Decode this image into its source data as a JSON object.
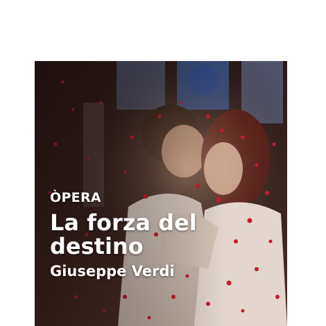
{
  "card": {
    "category": "ÒPERA",
    "title_line1": "La forza del",
    "title_line2": "destino",
    "composer": "Giuseppe Verdi"
  },
  "colors": {
    "background": "#ffffff",
    "text": "#ffffff",
    "petals": "#c41e2a"
  },
  "icons": {
    "artwork": "couple-embracing-photo"
  }
}
